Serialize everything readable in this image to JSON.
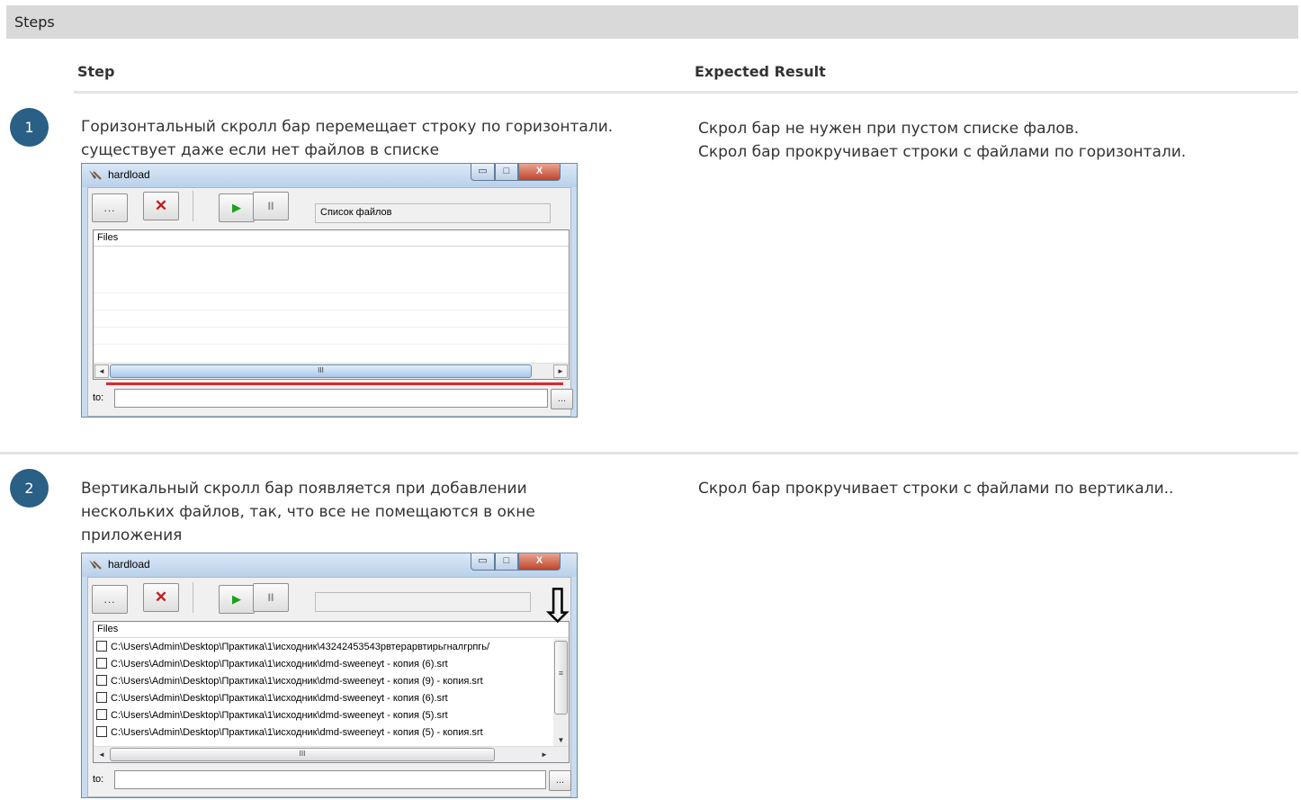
{
  "section_title": "Steps",
  "columns": {
    "step": "Step",
    "expected": "Expected Result"
  },
  "steps": [
    {
      "number": "1",
      "text_lines": [
        "Горизонтальный скролл бар перемещает строку по горизонтали.",
        "существует даже если нет файлов в списке"
      ],
      "expected_lines": [
        "Скрол бар не нужен при пустом списке фалов.",
        "Скрол бар прокручивает строки с файлами по горизонтали."
      ],
      "window": {
        "title": "hardload",
        "min_glyph": "▭",
        "max_glyph": "□",
        "close_glyph": "X",
        "browse_label": "...",
        "delete_glyph": "✕",
        "play_glyph": "▶",
        "pause_glyph": "II",
        "status_text": "Список файлов",
        "list_header": "Files",
        "left_arrow": "◄",
        "right_arrow": "►",
        "thumb_grip": "III",
        "to_label": "to:",
        "to_value": "",
        "to_browse_label": "..."
      }
    },
    {
      "number": "2",
      "text_lines": [
        "Вертикальный скролл бар появляется при добавлении",
        "нескольких файлов, так, что все не помещаются в окне",
        "приложения"
      ],
      "expected_lines": [
        "Скрол бар прокручивает строки с файлами по вертикали.."
      ],
      "window": {
        "title": "hardload",
        "min_glyph": "▭",
        "max_glyph": "□",
        "close_glyph": "X",
        "browse_label": "...",
        "delete_glyph": "✕",
        "play_glyph": "▶",
        "pause_glyph": "II",
        "status_text": "",
        "list_header": "Files",
        "files": [
          "C:\\Users\\Admin\\Desktop\\Практика\\1\\исходник\\43242453543рвтерарвтирьгналгрпгь/",
          "C:\\Users\\Admin\\Desktop\\Практика\\1\\исходник\\dmd-sweeneyt - копия (6).srt",
          "C:\\Users\\Admin\\Desktop\\Практика\\1\\исходник\\dmd-sweeneyt - копия (9) - копия.srt",
          "C:\\Users\\Admin\\Desktop\\Практика\\1\\исходник\\dmd-sweeneyt - копия (6).srt",
          "C:\\Users\\Admin\\Desktop\\Практика\\1\\исходник\\dmd-sweeneyt - копия (5).srt",
          "C:\\Users\\Admin\\Desktop\\Практика\\1\\исходник\\dmd-sweeneyt - копия (5) - копия.srt"
        ],
        "left_arrow": "◄",
        "right_arrow": "►",
        "down_arrow": "▼",
        "thumb_grip": "III",
        "vthumb_grip": "≡",
        "annotation_arrow": "⇩",
        "to_label": "to:",
        "to_value": "",
        "to_browse_label": "..."
      }
    }
  ],
  "colors": {
    "step_badge": "#2a5f86",
    "highlight_line": "#d9282f",
    "header_bg": "#d9d9d9"
  }
}
